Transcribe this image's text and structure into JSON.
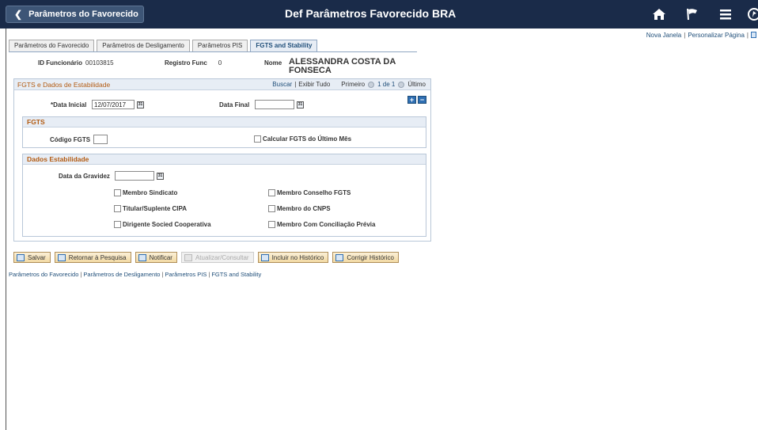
{
  "header": {
    "back_label": "Parâmetros do Favorecido",
    "title": "Def Parâmetros Favorecido BRA",
    "icons": [
      "home-icon",
      "flag-icon",
      "menu-icon",
      "navbar-icon"
    ]
  },
  "top_links": {
    "new_window": "Nova Janela",
    "personalize": "Personalizar Página"
  },
  "tabs": [
    {
      "label": "Parâmetros do Favorecido",
      "active": false
    },
    {
      "label": "Parâmetros de Desligamento",
      "active": false
    },
    {
      "label": "Parâmetros PIS",
      "active": false
    },
    {
      "label": "FGTS and Stability",
      "active": true
    }
  ],
  "employee": {
    "id_label": "ID Funcionário",
    "id_value": "00103815",
    "record_label": "Registro Func",
    "record_value": "0",
    "name_label": "Nome",
    "name_value": "ALESSANDRA COSTA DA FONSECA"
  },
  "section": {
    "title": "FGTS e Dados de Estabilidade",
    "find": "Buscar",
    "view_all": "Exibir Tudo",
    "first": "Primeiro",
    "counter": "1 de 1",
    "last": "Último",
    "start_date_label": "*Data Inicial",
    "start_date_value": "12/07/2017",
    "end_date_label": "Data Final",
    "end_date_value": ""
  },
  "fgts": {
    "title": "FGTS",
    "code_label": "Código FGTS",
    "code_value": "",
    "calc_last_month": "Calcular FGTS do Último Mês"
  },
  "stability": {
    "title": "Dados Estabilidade",
    "pregnancy_label": "Data da Gravidez",
    "pregnancy_value": "",
    "checkboxes": {
      "union_member": "Membro Sindicato",
      "cipa": "Titular/Suplente CIPA",
      "coop_director": "Dirigente Socied Cooperativa",
      "fgts_council": "Membro Conselho FGTS",
      "cnps": "Membro do CNPS",
      "conciliation": "Membro Com Conciliação Prévia"
    }
  },
  "toolbar": {
    "save": "Salvar",
    "return_search": "Retornar à Pesquisa",
    "notify": "Notificar",
    "refresh": "Atualizar/Consultar",
    "insert_history": "Incluir no Histórico",
    "correct_history": "Corrigir Histórico"
  },
  "bottom_links": [
    "Parâmetros do Favorecido",
    "Parâmetros de Desligamento",
    "Parâmetros PIS",
    "FGTS and Stability"
  ]
}
